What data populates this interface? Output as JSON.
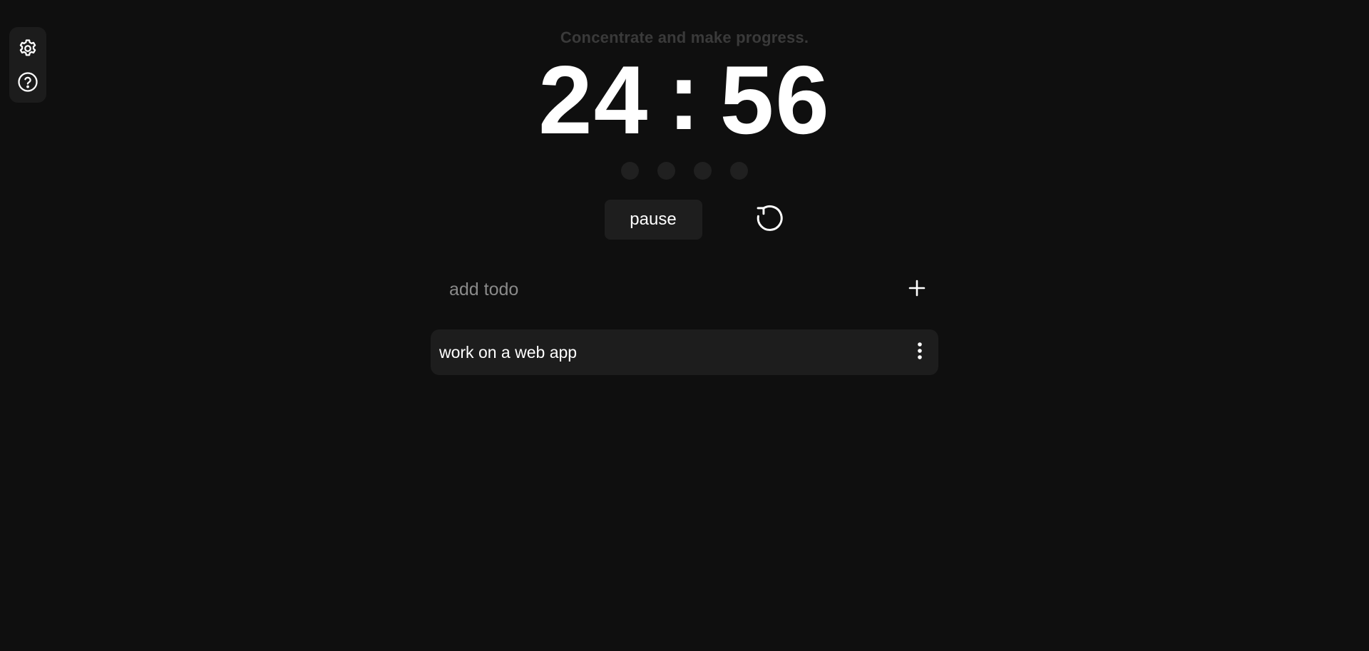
{
  "sidebar": {
    "items": [
      {
        "name": "settings",
        "icon": "gear-icon"
      },
      {
        "name": "help",
        "icon": "help-circle-icon"
      }
    ]
  },
  "header": {
    "tagline": "Concentrate and make progress."
  },
  "timer": {
    "minutes": "24",
    "separator": ":",
    "seconds": "56"
  },
  "session_dots": {
    "total": 4,
    "completed": 0
  },
  "controls": {
    "pause_label": "pause",
    "reset_icon": "reset-icon"
  },
  "todo_input": {
    "placeholder": "add todo",
    "value": "",
    "add_icon": "plus-icon"
  },
  "todos": [
    {
      "text": "work on a web app",
      "menu_icon": "more-vertical-icon"
    }
  ],
  "colors": {
    "background": "#0f0f0f",
    "surface": "#1d1d1d",
    "text": "#ffffff",
    "muted": "#3a3a3a",
    "placeholder": "#8a8a8a"
  }
}
